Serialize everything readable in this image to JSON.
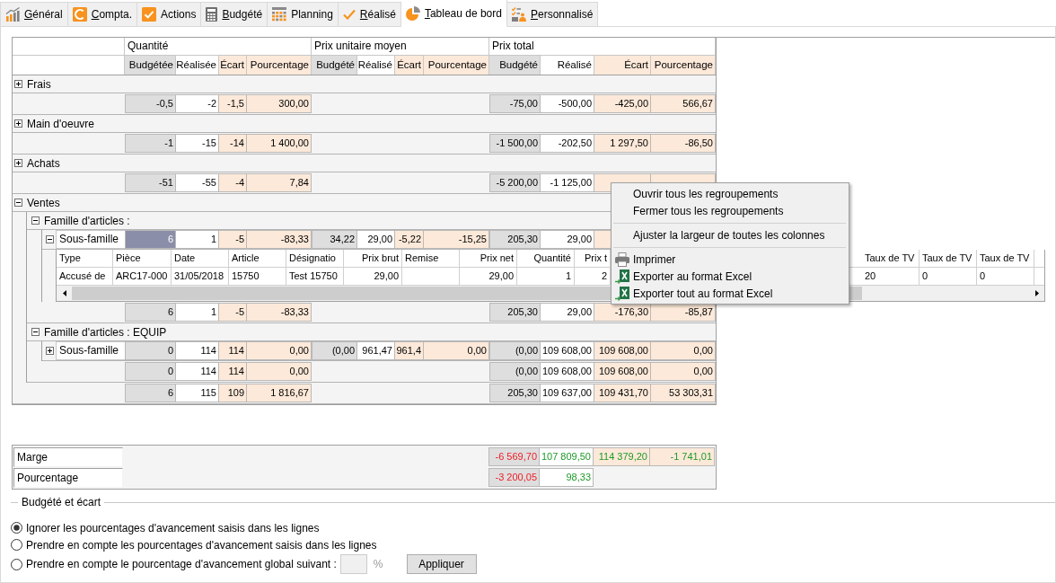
{
  "tabs": [
    {
      "label": "Général",
      "mnemonic": true,
      "selected": false
    },
    {
      "label": "Compta.",
      "mnemonic": true,
      "selected": false
    },
    {
      "label": "Actions",
      "mnemonic": false,
      "selected": false
    },
    {
      "label": "Budgété",
      "mnemonic": true,
      "selected": false
    },
    {
      "label": "Planning",
      "mnemonic": false,
      "selected": false
    },
    {
      "label": "Réalisé",
      "mnemonic": true,
      "selected": false
    },
    {
      "label": "Tableau de bord",
      "mnemonic": true,
      "selected": true
    },
    {
      "label": "Personnalisé",
      "mnemonic": true,
      "selected": false
    }
  ],
  "grid": {
    "column_groups": [
      {
        "title": "Quantité",
        "columns": [
          {
            "label": "Budgétée",
            "kind": "budget"
          },
          {
            "label": "Réalisée",
            "kind": "actual"
          },
          {
            "label": "Écart",
            "kind": "variance"
          },
          {
            "label": "Pourcentage",
            "kind": "percent"
          }
        ]
      },
      {
        "title": "Prix unitaire moyen",
        "columns": [
          {
            "label": "Budgété",
            "kind": "budget"
          },
          {
            "label": "Réalisé",
            "kind": "actual"
          },
          {
            "label": "Écart",
            "kind": "variance"
          },
          {
            "label": "Pourcentage",
            "kind": "percent"
          }
        ]
      },
      {
        "title": "Prix total",
        "columns": [
          {
            "label": "Budgété",
            "kind": "budget"
          },
          {
            "label": "Réalisé",
            "kind": "actual"
          },
          {
            "label": "Écart",
            "kind": "variance"
          },
          {
            "label": "Pourcentage",
            "kind": "percent"
          }
        ]
      }
    ],
    "rows": [
      {
        "label": "Frais",
        "expanded": false,
        "totals": {
          "quantity": [
            "-0,5",
            "-2",
            "-1,5",
            "300,00"
          ],
          "total_price": [
            "-75,00",
            "-500,00",
            "-425,00",
            "566,67"
          ]
        }
      },
      {
        "label": "Main d'oeuvre",
        "expanded": false,
        "totals": {
          "quantity": [
            "-1",
            "-15",
            "-14",
            "1 400,00"
          ],
          "total_price": [
            "-1 500,00",
            "-202,50",
            "1 297,50",
            "-86,50"
          ]
        }
      },
      {
        "label": "Achats",
        "expanded": false,
        "totals": {
          "quantity": [
            "-51",
            "-55",
            "-4",
            "7,84"
          ],
          "total_price": [
            "-5 200,00",
            "-1 125,00"
          ]
        }
      },
      {
        "label": "Ventes",
        "expanded": true,
        "children": [
          {
            "label": "Famille d'articles :",
            "expanded": true,
            "children": [
              {
                "label": "Sous-famille",
                "expanded": true,
                "selected": true,
                "values": {
                  "quantity": [
                    "6",
                    "1",
                    "-5",
                    "-83,33"
                  ],
                  "unit_price": [
                    "34,22",
                    "29,00",
                    "-5,22",
                    "-15,25"
                  ],
                  "total_price": [
                    "205,30",
                    "29,00"
                  ]
                },
                "detail": {
                  "columns": [
                    {
                      "label": "Type",
                      "kind": "text"
                    },
                    {
                      "label": "Pièce",
                      "kind": "text"
                    },
                    {
                      "label": "Date",
                      "kind": "text"
                    },
                    {
                      "label": "Article",
                      "kind": "text"
                    },
                    {
                      "label": "Désignatio",
                      "kind": "text"
                    },
                    {
                      "label": "Prix brut",
                      "kind": "number"
                    },
                    {
                      "label": "Remise",
                      "kind": "text"
                    },
                    {
                      "label": "Prix net",
                      "kind": "number"
                    },
                    {
                      "label": "Quantité",
                      "kind": "number"
                    },
                    {
                      "label": "Prix t",
                      "kind": "number"
                    },
                    null,
                    {
                      "label": "Taux de TV",
                      "kind": "text"
                    },
                    {
                      "label": "Taux de TV",
                      "kind": "text"
                    },
                    {
                      "label": "Taux de TV",
                      "kind": "text"
                    }
                  ],
                  "rows": [
                    [
                      "Accusé de",
                      "ARC17-000",
                      "31/05/2018",
                      "15750",
                      "Test 15750",
                      "29,00",
                      null,
                      "29,00",
                      "1",
                      "2",
                      null,
                      "20",
                      "0",
                      "0"
                    ]
                  ]
                }
              }
            ],
            "totals": {
              "quantity": [
                "6",
                "1",
                "-5",
                "-83,33"
              ],
              "total_price": [
                "205,30",
                "29,00",
                "-176,30",
                "-85,87"
              ]
            }
          },
          {
            "label": "Famille d'articles : EQUIP",
            "expanded": true,
            "children": [
              {
                "label": "Sous-famille",
                "expanded": false,
                "selected": false,
                "values": {
                  "quantity": [
                    "0",
                    "114",
                    "114",
                    "0,00"
                  ],
                  "unit_price": [
                    "(0,00",
                    "961,47",
                    "961,4",
                    "0,00"
                  ],
                  "total_price": [
                    "(0,00",
                    "109 608,00",
                    "109 608,00",
                    "0,00"
                  ]
                }
              }
            ],
            "totals": {
              "quantity": [
                "0",
                "114",
                "114",
                "0,00"
              ],
              "total_price": [
                "(0,00",
                "109 608,00",
                "109 608,00",
                "0,00"
              ]
            }
          }
        ],
        "totals": {
          "quantity": [
            "6",
            "115",
            "109",
            "1 816,67"
          ],
          "total_price": [
            "205,30",
            "109 637,00",
            "109 431,70",
            "53 303,31"
          ]
        }
      }
    ]
  },
  "margins": [
    {
      "label": "Marge",
      "values": [
        {
          "text": "-6 569,70",
          "color": "#ee1c25"
        },
        {
          "text": "107 809,50",
          "color": "#1e9a28"
        },
        {
          "text": "114 379,20",
          "color": "#1e9a28"
        },
        {
          "text": "-1 741,01",
          "color": "#1e9a28"
        }
      ]
    },
    {
      "label": "Pourcentage",
      "values": [
        {
          "text": "-3 200,05",
          "color": "#ee1c25"
        },
        {
          "text": "98,33",
          "color": "#1e9a28"
        }
      ]
    }
  ],
  "progress_options": {
    "title": "Budgété et écart",
    "options": [
      {
        "label": "Ignorer les pourcentages d'avancement saisis dans les lignes",
        "selected": true
      },
      {
        "label": "Prendre en compte les pourcentages d'avancement saisis dans les lignes",
        "selected": false
      },
      {
        "label": "Prendre en compte le pourcentage d'avancement global suivant :",
        "selected": false
      }
    ],
    "percent_input": {
      "disabled": true,
      "unit": "%"
    },
    "apply_button": "Appliquer"
  },
  "context_menu": {
    "sections": [
      [
        "Ouvrir tous les regroupements",
        "Fermer tous les regroupements"
      ],
      [
        "Ajuster la largeur de toutes les colonnes"
      ],
      [
        "Imprimer",
        "Exporter au format Excel",
        "Exporter tout au format Excel"
      ]
    ]
  }
}
